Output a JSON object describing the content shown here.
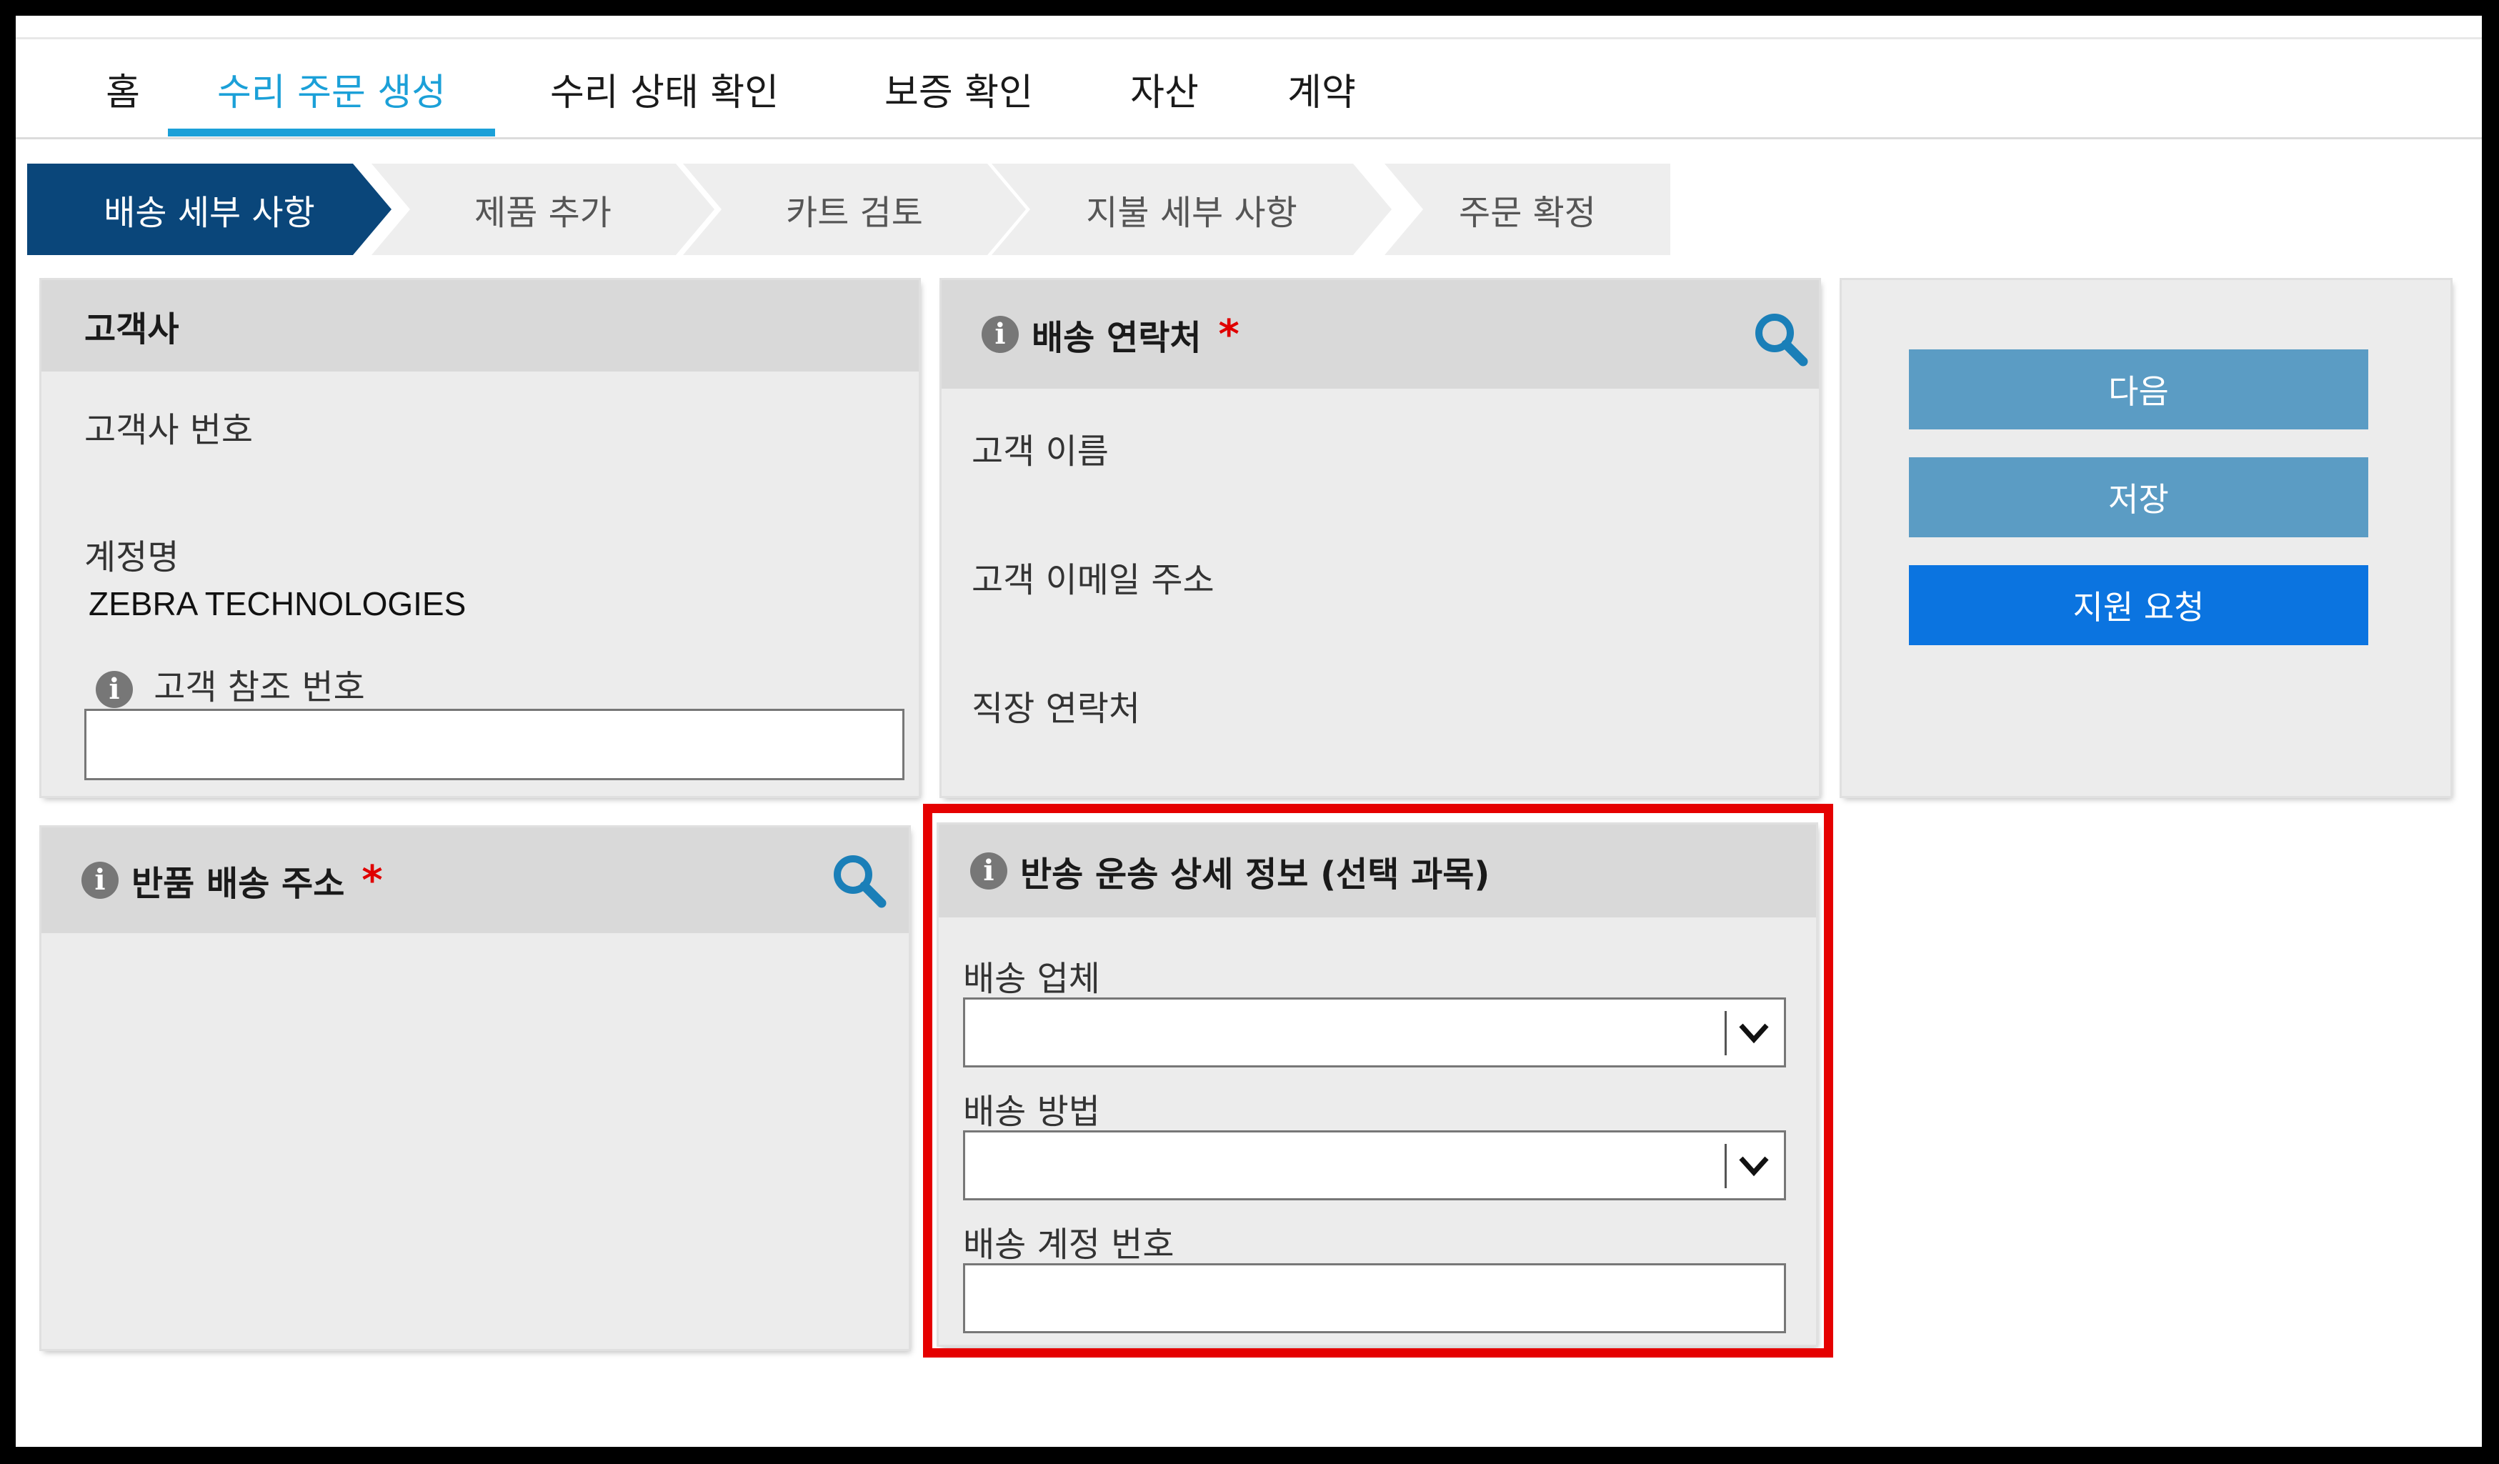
{
  "nav": {
    "items": [
      "홈",
      "수리 주문 생성",
      "수리 상태 확인",
      "보증 확인",
      "자산",
      "계약"
    ],
    "active_index": 1
  },
  "steps": [
    "배송 세부 사항",
    "제품 추가",
    "카트 검토",
    "지불 세부 사항",
    "주문 확정"
  ],
  "customer_panel": {
    "title": "고객사",
    "customer_number_label": "고객사 번호",
    "customer_number_value": "",
    "account_name_label": "계정명",
    "account_name_value": "ZEBRA TECHNOLOGIES",
    "reference_label": "고객 참조 번호",
    "reference_value": ""
  },
  "contact_panel": {
    "title": "배송 연락처",
    "required_mark": "*",
    "name_label": "고객 이름",
    "email_label": "고객 이메일 주소",
    "work_contact_label": "직장 연락처"
  },
  "actions": {
    "next": "다음",
    "save": "저장",
    "support": "지원 요청"
  },
  "return_address_panel": {
    "title": "반품 배송 주소",
    "required_mark": "*"
  },
  "return_shipping_panel": {
    "title": "반송 운송 상세 정보 (선택 과목)",
    "carrier_label": "배송 업체",
    "carrier_value": "",
    "method_label": "배송 방법",
    "method_value": "",
    "account_label": "배송 계정 번호",
    "account_value": ""
  },
  "colors": {
    "accent": "#1ba0d8",
    "step_active": "#0a467a",
    "button_gray": "#5b9cc4",
    "button_blue": "#0b74e0",
    "highlight": "#e50000",
    "required": "#e00000"
  }
}
